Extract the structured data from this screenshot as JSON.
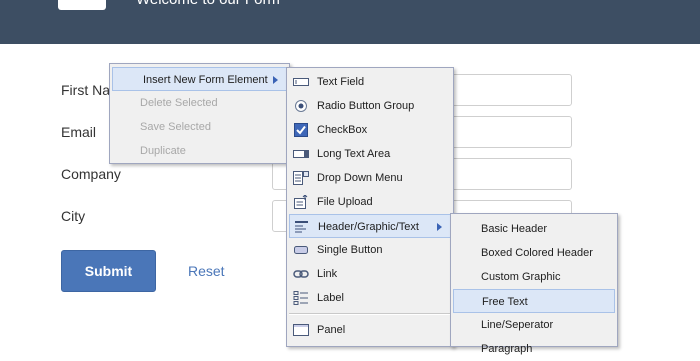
{
  "header": {
    "title": "Welcome to our Form"
  },
  "form": {
    "fields": [
      {
        "label": "First Na"
      },
      {
        "label": "Email"
      },
      {
        "label": "Company"
      },
      {
        "label": "City"
      }
    ],
    "submit_label": "Submit",
    "reset_label": "Reset"
  },
  "context_menu": {
    "items": [
      {
        "label": "Insert New Form Element",
        "state": "highlighted",
        "has_submenu": true
      },
      {
        "label": "Delete Selected",
        "state": "disabled"
      },
      {
        "label": "Save Selected",
        "state": "disabled"
      },
      {
        "label": "Duplicate",
        "state": "disabled"
      }
    ]
  },
  "elements_menu": {
    "items": [
      {
        "label": "Text Field",
        "icon": "text-field-icon"
      },
      {
        "label": "Radio Button Group",
        "icon": "radio-button-icon"
      },
      {
        "label": "CheckBox",
        "icon": "checkbox-icon"
      },
      {
        "label": "Long Text Area",
        "icon": "text-area-icon"
      },
      {
        "label": "Drop Down Menu",
        "icon": "dropdown-icon"
      },
      {
        "label": "File Upload",
        "icon": "file-upload-icon"
      },
      {
        "label": "Header/Graphic/Text",
        "icon": "header-text-icon",
        "state": "highlighted",
        "has_submenu": true
      },
      {
        "label": "Single Button",
        "icon": "button-icon"
      },
      {
        "label": "Link",
        "icon": "link-icon"
      },
      {
        "label": "Label",
        "icon": "label-icon"
      },
      {
        "label": "Panel",
        "icon": "panel-icon"
      }
    ]
  },
  "header_menu": {
    "items": [
      {
        "label": "Basic Header"
      },
      {
        "label": "Boxed Colored Header"
      },
      {
        "label": "Custom Graphic"
      },
      {
        "label": "Free Text",
        "state": "highlighted"
      },
      {
        "label": "Line/Seperator"
      },
      {
        "label": "Paragraph"
      }
    ]
  }
}
